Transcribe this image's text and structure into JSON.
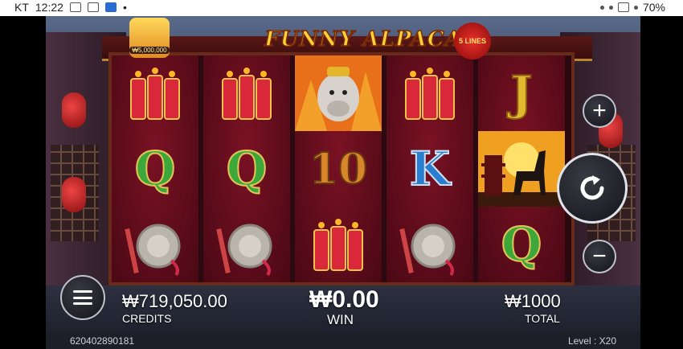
{
  "status_bar": {
    "carrier": "KT",
    "time": "12:22",
    "dot": "•",
    "battery": "70%"
  },
  "game": {
    "title": "FUNNY ALPACA",
    "lines_badge": "5 LINES",
    "jackpot_amount": "₩5,000,000"
  },
  "reels": [
    [
      "firecrackers",
      "Q",
      "gong"
    ],
    [
      "firecrackers",
      "Q",
      "gong"
    ],
    [
      "alpaca",
      "10",
      "firecrackers"
    ],
    [
      "firecrackers",
      "K",
      "gong"
    ],
    [
      "J",
      "alpaca-sunset",
      "Q"
    ]
  ],
  "controls": {
    "plus_symbol": "+",
    "minus_symbol": "−",
    "spin_icon": "refresh-icon",
    "menu_icon": "menu-icon"
  },
  "panel": {
    "credits_value": "₩719,050.00",
    "credits_label": "CREDITS",
    "win_value": "₩0.00",
    "win_label": "WIN",
    "total_value": "₩1000",
    "total_label": "TOTAL"
  },
  "footer": {
    "game_id": "620402890181",
    "level_label": "Level : X20"
  },
  "colors": {
    "reel_bg": "#6a0e20",
    "frame": "#6a2a1a",
    "gold": "#ffd23a"
  }
}
